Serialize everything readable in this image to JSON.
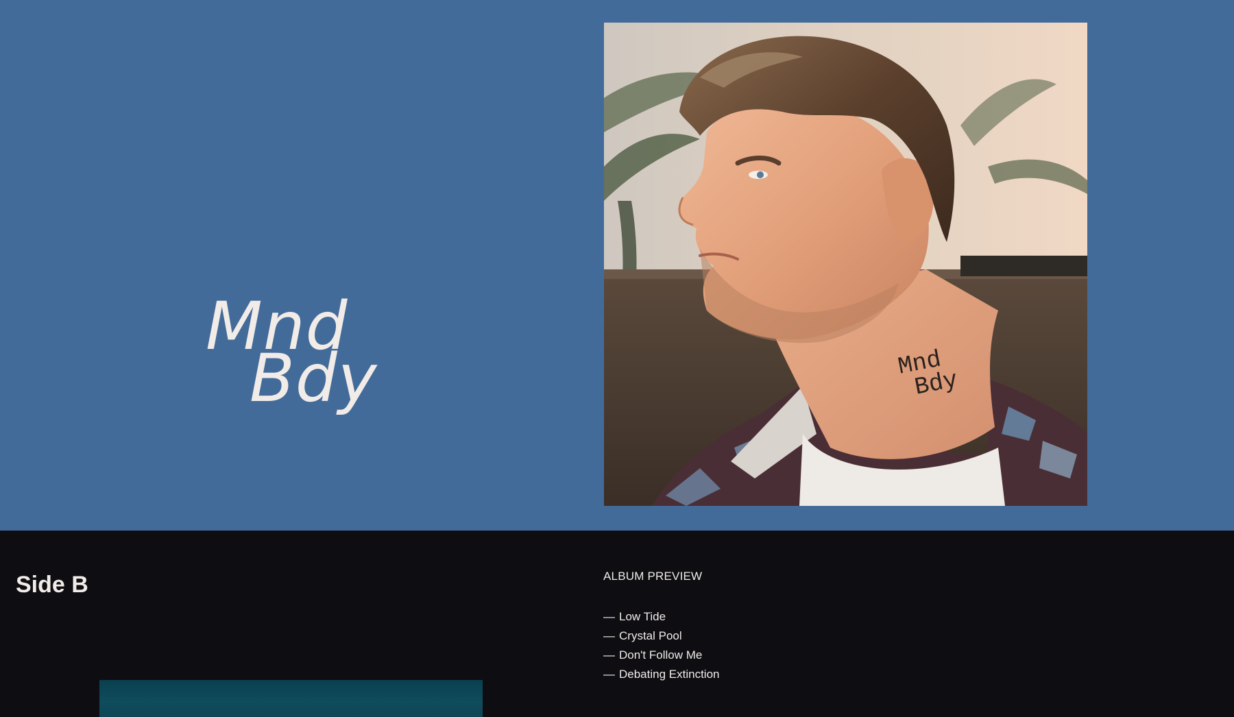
{
  "hero": {
    "title_line1": "Mnd",
    "title_line2": "Bdy",
    "background_color": "#436b9a"
  },
  "album_cover": {
    "tattoo_line1": "Mnd",
    "tattoo_line2": "Bdy"
  },
  "side_b": {
    "title": "Side B",
    "background_color": "#0d0d12"
  },
  "album_preview": {
    "heading": "ALBUM PREVIEW",
    "dash": "—",
    "tracks": [
      "Low Tide",
      "Crystal Pool",
      "Don't Follow Me",
      "Debating Extinction"
    ]
  }
}
